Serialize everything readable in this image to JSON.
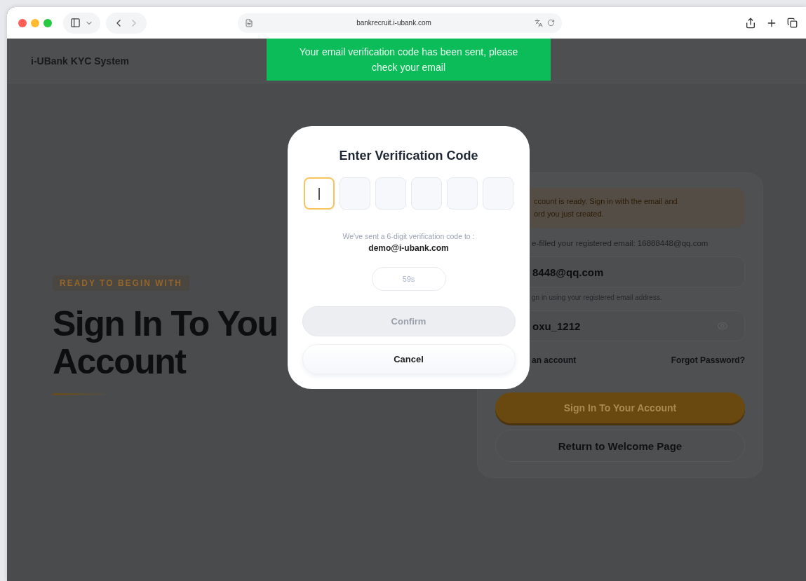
{
  "browser": {
    "url": "bankrecruit.i-ubank.com"
  },
  "header": {
    "title": "i-UBank KYC System"
  },
  "toast": {
    "message": "Your email verification code has been sent, please check your email"
  },
  "hero": {
    "eyebrow": "READY TO BEGIN WITH",
    "heading_lines": [
      "Sign In To You",
      "Account"
    ]
  },
  "card": {
    "notice_lines": [
      "ccount is ready. Sign in with the email and",
      "ord you just created."
    ],
    "prefill_note": "e-filled your registered email: 16888448@qq.com",
    "email": {
      "value": "8448@qq.com",
      "hint": "gn in using your registered email address."
    },
    "password": {
      "value": "oxu_1212"
    },
    "create_link": "an account",
    "forgot_link": "Forgot Password?",
    "sign_in_button": "Sign In To Your Account",
    "return_button": "Return to Welcome Page"
  },
  "modal": {
    "title": "Enter Verification Code",
    "code_boxes": [
      {
        "selected": true
      },
      {
        "selected": false
      },
      {
        "selected": false
      },
      {
        "selected": false
      },
      {
        "selected": false
      },
      {
        "selected": false
      }
    ],
    "sent_text": "We've sent a 6-digit verification code to :",
    "email": "demo@i-ubank.com",
    "timer": "59s",
    "confirm": {
      "label": "Confirm",
      "disabled": true
    },
    "cancel": "Cancel"
  }
}
